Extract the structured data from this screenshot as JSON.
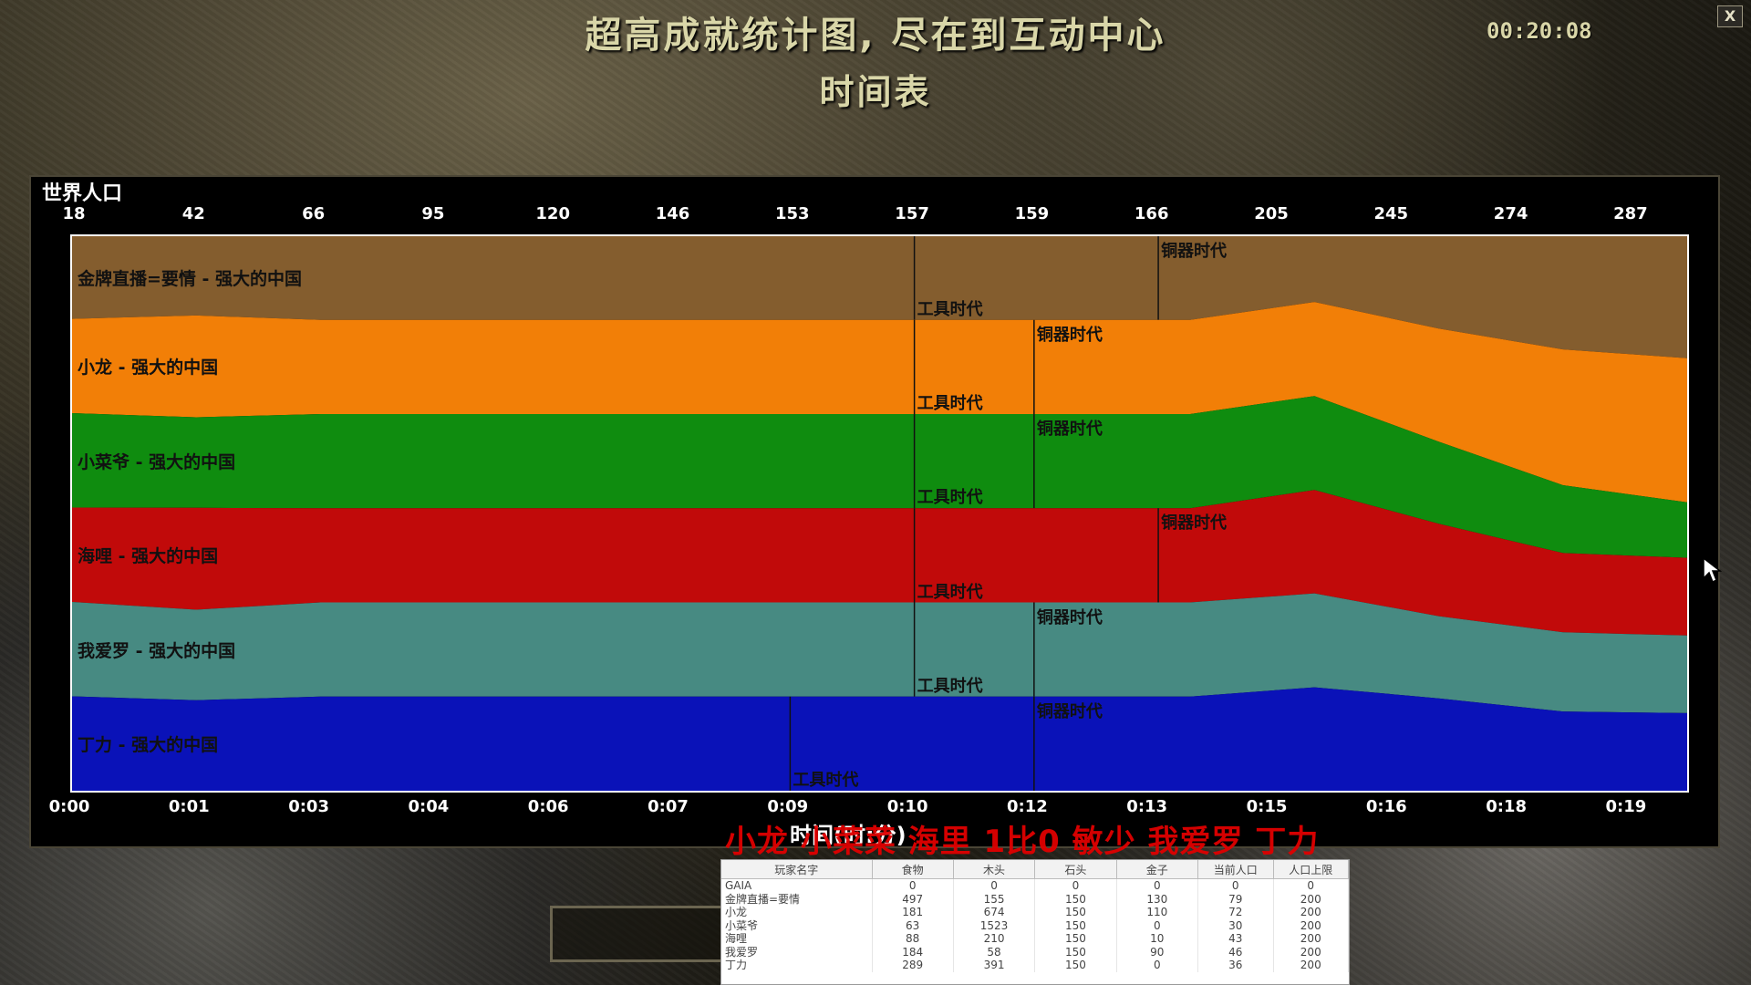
{
  "header": {
    "title": "超高成就统计图, 尽在到互动中心",
    "subtitle": "时间表",
    "clock": "00:20:08",
    "close_label": "X"
  },
  "panel": {
    "title": "世界人口",
    "x_axis_title": "时间(时:分)",
    "top_population_labels": [
      "18",
      "42",
      "66",
      "95",
      "120",
      "146",
      "153",
      "157",
      "159",
      "166",
      "205",
      "245",
      "274",
      "287"
    ],
    "time_labels": [
      "0:00",
      "0:01",
      "0:03",
      "0:04",
      "0:06",
      "0:07",
      "0:09",
      "0:10",
      "0:12",
      "0:13",
      "0:15",
      "0:16",
      "0:18",
      "0:19"
    ]
  },
  "chart_data": {
    "type": "area",
    "title": "世界人口",
    "xlabel": "时间(时:分)",
    "x": [
      "0:00",
      "0:01",
      "0:03",
      "0:04",
      "0:06",
      "0:07",
      "0:09",
      "0:10",
      "0:12",
      "0:13",
      "0:15",
      "0:16",
      "0:18",
      "0:19"
    ],
    "series": [
      {
        "name": "金牌直播=要情 - 强大的中国",
        "color": "#845d2e",
        "values": [
          7,
          7,
          8,
          8,
          8,
          8,
          8,
          8,
          8,
          8,
          7,
          9,
          10,
          11
        ],
        "ages": [
          {
            "label": "工具时代",
            "time": "0:10"
          },
          {
            "label": "铜器时代",
            "time": "0:13"
          }
        ]
      },
      {
        "name": "小龙 - 强大的中国",
        "color": "#f27f07",
        "values": [
          8,
          9,
          9,
          9,
          9,
          9,
          9,
          9,
          9,
          9,
          10,
          11,
          12,
          13
        ],
        "ages": [
          {
            "label": "工具时代",
            "time": "0:10"
          },
          {
            "label": "铜器时代",
            "time": "0:12"
          }
        ]
      },
      {
        "name": "小菜爷 - 强大的中国",
        "color": "#0f8c0f",
        "values": [
          8,
          8,
          9,
          9,
          9,
          9,
          9,
          9,
          9,
          9,
          10,
          8,
          6,
          5
        ],
        "ages": [
          {
            "label": "工具时代",
            "time": "0:10"
          },
          {
            "label": "铜器时代",
            "time": "0:12"
          }
        ]
      },
      {
        "name": "海哩 - 强大的中国",
        "color": "#c10a0a",
        "values": [
          8,
          9,
          9,
          9,
          9,
          9,
          9,
          9,
          9,
          9,
          11,
          9,
          7,
          7
        ],
        "ages": [
          {
            "label": "工具时代",
            "time": "0:10"
          },
          {
            "label": "铜器时代",
            "time": "0:13"
          }
        ]
      },
      {
        "name": "我爱罗 - 强大的中国",
        "color": "#478a82",
        "values": [
          8,
          8,
          9,
          9,
          9,
          9,
          9,
          9,
          9,
          9,
          10,
          8,
          7,
          7
        ],
        "ages": [
          {
            "label": "工具时代",
            "time": "0:10"
          },
          {
            "label": "铜器时代",
            "time": "0:12"
          }
        ]
      },
      {
        "name": "丁力 - 强大的中国",
        "color": "#0a12b8",
        "values": [
          8,
          8,
          9,
          9,
          9,
          9,
          9,
          9,
          9,
          9,
          11,
          9,
          7,
          7
        ],
        "ages": [
          {
            "label": "工具时代",
            "time": "0:09"
          },
          {
            "label": "铜器时代",
            "time": "0:12"
          }
        ]
      }
    ]
  },
  "overlay_chat": "小龙 小菜菜 海里  1比0  敏少 我爱罗 丁力",
  "stats_table": {
    "headers": [
      "玩家名字",
      "食物",
      "木头",
      "石头",
      "金子",
      "当前人口",
      "人口上限"
    ],
    "rows": [
      [
        "GAIA",
        "0",
        "0",
        "0",
        "0",
        "0",
        "0"
      ],
      [
        "金牌直播=要情",
        "497",
        "155",
        "150",
        "130",
        "79",
        "200"
      ],
      [
        "小龙",
        "181",
        "674",
        "150",
        "110",
        "72",
        "200"
      ],
      [
        "小菜爷",
        "63",
        "1523",
        "150",
        "0",
        "30",
        "200"
      ],
      [
        "海哩",
        "88",
        "210",
        "150",
        "10",
        "43",
        "200"
      ],
      [
        "我爱罗",
        "184",
        "58",
        "150",
        "90",
        "46",
        "200"
      ],
      [
        "丁力",
        "289",
        "391",
        "150",
        "0",
        "36",
        "200"
      ]
    ]
  }
}
